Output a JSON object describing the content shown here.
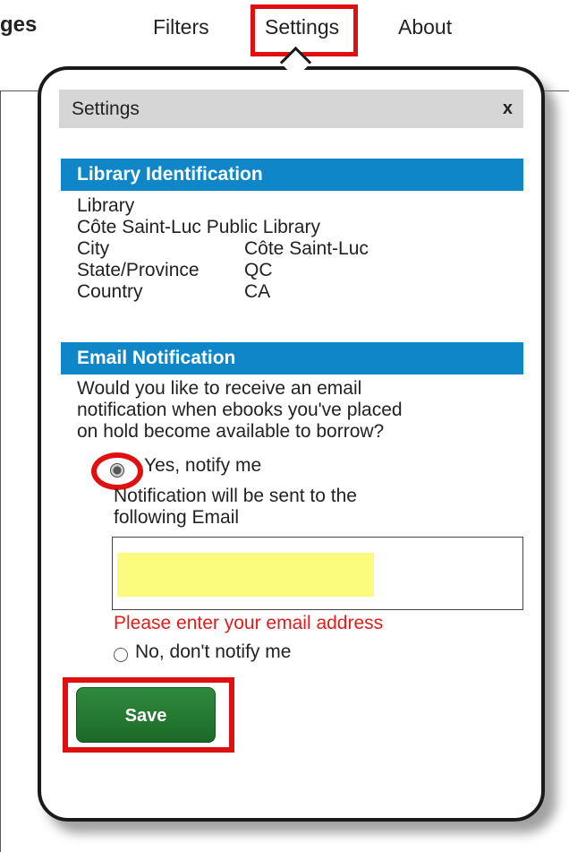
{
  "site": {
    "title_fragment": "ges"
  },
  "nav": {
    "filters_label": "Filters",
    "settings_label": "Settings",
    "about_label": "About"
  },
  "dialog": {
    "title": "Settings",
    "close_label": "x",
    "library_section": {
      "heading": "Library Identification",
      "library_label": "Library",
      "library_value": "Côte Saint-Luc Public Library",
      "city_label": "City",
      "city_value": "Côte Saint-Luc",
      "state_label": "State/Province",
      "state_value": "QC",
      "country_label": "Country",
      "country_value": "CA"
    },
    "email_section": {
      "heading": "Email Notification",
      "question_lines": [
        "Would you like to receive an email",
        "notification when ebooks you've placed",
        "on hold become available to borrow?"
      ],
      "option_yes": "Yes, notify me",
      "option_yes_selected": true,
      "note_lines": [
        "Notification will be sent to the",
        "following Email"
      ],
      "email_value": "",
      "error_text": "Please enter your email address",
      "option_no": "No, don't notify me",
      "option_no_selected": false
    },
    "save_label": "Save"
  },
  "colors": {
    "section_bar": "#0f86c8",
    "header_bg": "#d6d6d6",
    "error": "#e21b1b",
    "save_button": "#247a31",
    "highlight": "#e01010",
    "redaction": "#fbfb7e"
  }
}
